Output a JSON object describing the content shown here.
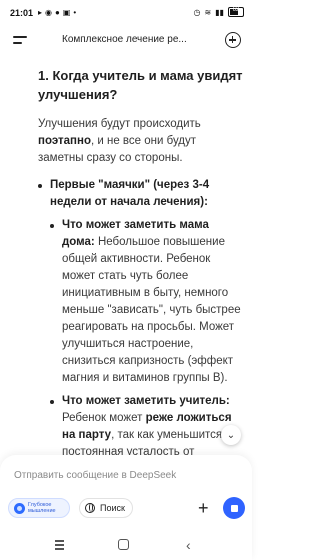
{
  "status": {
    "time": "21:01",
    "battery": "62"
  },
  "header": {
    "title": "Комплексное лечение ре..."
  },
  "message": {
    "heading": "1. Когда учитель и мама увидят улучшения?",
    "intro_pre": "Улучшения будут происходить ",
    "intro_bold": "поэтапно",
    "intro_post": ", и не все они будут заметны сразу со стороны.",
    "bullet_bold": "Первые \"маячки\" (через 3-4 недели от начала лечения):",
    "sub1_bold": "Что может заметить мама дома:",
    "sub1_text": " Небольшое повышение общей активности. Ребенок может стать чуть более инициативным в быту, немного меньше \"зависать\", чуть быстрее реагировать на просьбы. Может улучшиться настроение, снизиться капризность (эффект магния и витаминов группы В).",
    "sub2_bold": "Что может заметить учитель:",
    "sub2_pre": " Ребенок может ",
    "sub2_bold2": "реже ложиться на парту",
    "sub2_post": ", так как уменьшится постоянная усталость от недостатка кровоснабжения"
  },
  "composer": {
    "placeholder": "Отправить сообщение в DeepSeek",
    "deepthink_label": "Глубокое мышление",
    "search_label": "Поиск"
  },
  "colors": {
    "accent": "#2f63ff"
  }
}
